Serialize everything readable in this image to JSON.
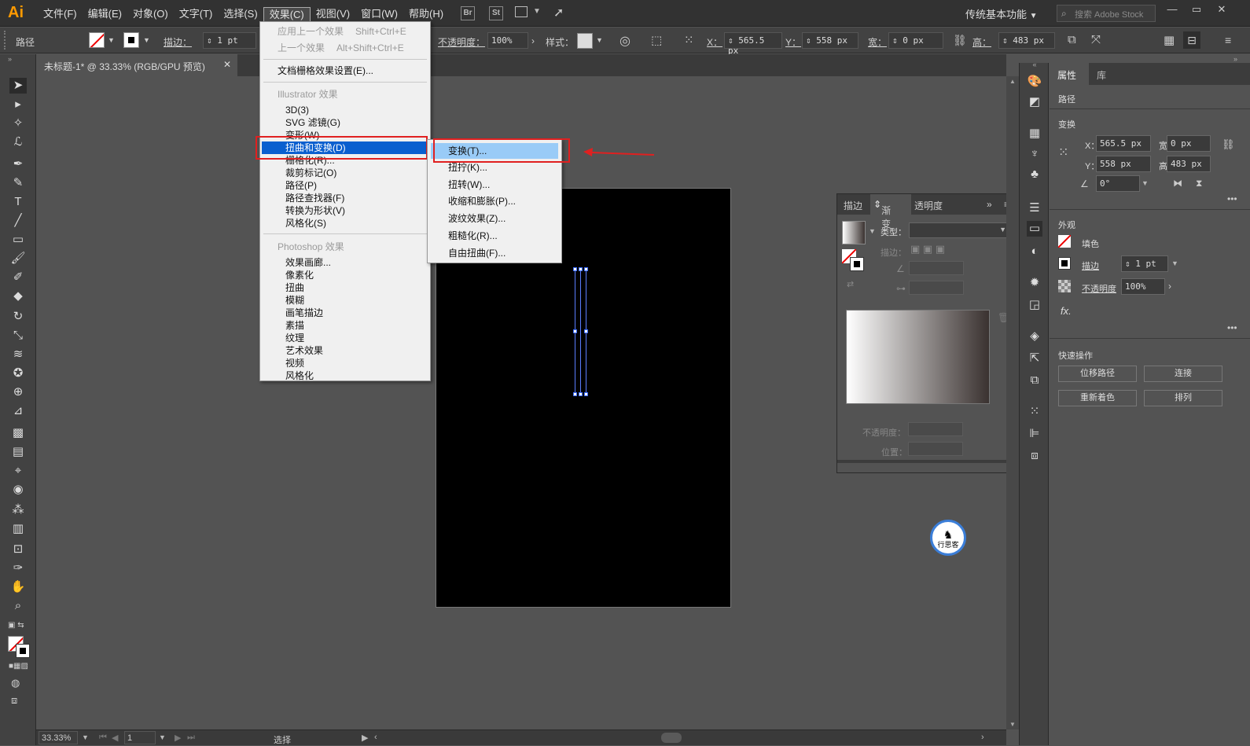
{
  "menubar": {
    "logo": "Ai",
    "items": [
      "文件(F)",
      "编辑(E)",
      "对象(O)",
      "文字(T)",
      "选择(S)",
      "效果(C)",
      "视图(V)",
      "窗口(W)",
      "帮助(H)"
    ],
    "br": "Br",
    "st": "St",
    "workspace": "传统基本功能",
    "search_placeholder": "搜索 Adobe Stock"
  },
  "controlbar": {
    "object_type": "路径",
    "stroke_label": "描边：",
    "stroke_value": "1 pt",
    "opacity_label": "不透明度：",
    "opacity_value": "100%",
    "style_label": "样式：",
    "x_label": "X：",
    "x_value": "565.5 px",
    "y_label": "Y：",
    "y_value": "558 px",
    "w_label": "宽：",
    "w_value": "0 px",
    "h_label": "高：",
    "h_value": "483 px"
  },
  "document_tab": "未标题-1* @ 33.33% (RGB/GPU 预览)",
  "effect_menu": {
    "apply_last": "应用上一个效果",
    "apply_last_shortcut": "Shift+Ctrl+E",
    "last_effect": "上一个效果",
    "last_effect_shortcut": "Alt+Shift+Ctrl+E",
    "raster_settings": "文档栅格效果设置(E)...",
    "illustrator_header": "Illustrator 效果",
    "illustrator_items": [
      "3D(3)",
      "SVG 滤镜(G)",
      "变形(W)",
      "扭曲和变换(D)",
      "栅格化(R)...",
      "裁剪标记(O)",
      "路径(P)",
      "路径查找器(F)",
      "转换为形状(V)",
      "风格化(S)"
    ],
    "photoshop_header": "Photoshop 效果",
    "photoshop_items": [
      "效果画廊...",
      "像素化",
      "扭曲",
      "模糊",
      "画笔描边",
      "素描",
      "纹理",
      "艺术效果",
      "视频",
      "风格化"
    ]
  },
  "distort_submenu": {
    "items": [
      "变换(T)...",
      "扭拧(K)...",
      "扭转(W)...",
      "收缩和膨胀(P)...",
      "波纹效果(Z)...",
      "粗糙化(R)...",
      "自由扭曲(F)..."
    ]
  },
  "gradient_panel": {
    "tabs": [
      "描边",
      "渐变",
      "透明度"
    ],
    "type_label": "类型：",
    "stroke_label": "描边：",
    "opacity_label": "不透明度：",
    "location_label": "位置："
  },
  "properties_panel": {
    "tabs": [
      "属性",
      "库"
    ],
    "object_type": "路径",
    "transform_header": "变换",
    "x_label": "X：",
    "x_value": "565.5 px",
    "y_label": "Y：",
    "y_value": "558 px",
    "w_label": "宽：",
    "w_value": "0 px",
    "h_label": "高：",
    "h_value": "483 px",
    "angle_value": "0°",
    "appearance_header": "外观",
    "fill_label": "填色",
    "stroke_label": "描边",
    "stroke_value": "1 pt",
    "opacity_label": "不透明度",
    "opacity_value": "100%",
    "fx_label": "fx.",
    "quick_actions_header": "快速操作",
    "btn_offset_path": "位移路径",
    "btn_join": "连接",
    "btn_recolor": "重新着色",
    "btn_arrange": "排列"
  },
  "statusbar": {
    "zoom": "33.33%",
    "page": "1",
    "tool": "选择"
  },
  "watermark_text": "行思客",
  "colors": {
    "menu_highlight": "#0a5fcf",
    "submenu_highlight": "#99cbf7",
    "annotation_red": "#e02020",
    "ai_orange": "#ff9a00"
  }
}
